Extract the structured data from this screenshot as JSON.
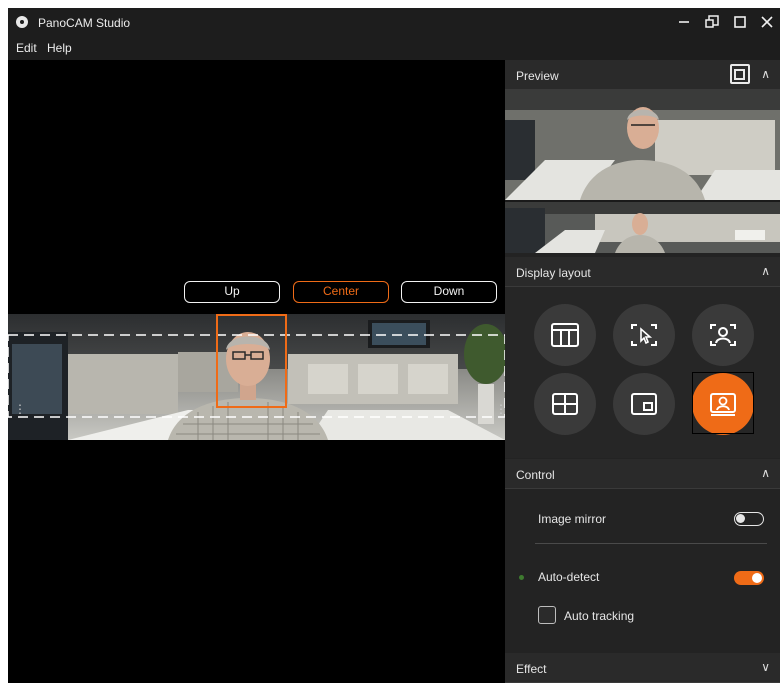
{
  "titlebar": {
    "title": "PanoCAM Studio",
    "app_icon": "camera-lens-icon",
    "controls": [
      "minimize-icon",
      "restore-icon",
      "maximize-icon",
      "close-icon"
    ]
  },
  "menu": {
    "items": [
      "Edit",
      "Help"
    ]
  },
  "video": {
    "buttons": [
      {
        "label": "Up",
        "active": false
      },
      {
        "label": "Center",
        "active": true
      },
      {
        "label": "Down",
        "active": false
      }
    ]
  },
  "panel": {
    "preview": {
      "title": "Preview",
      "icon": "picture-in-picture-collapse-icon"
    },
    "display_layout": {
      "title": "Display layout",
      "options": [
        {
          "icon": "grid-layout-icon",
          "active": false
        },
        {
          "icon": "cursor-frame-icon",
          "active": false
        },
        {
          "icon": "person-frame-icon",
          "active": false
        },
        {
          "icon": "quad-layout-icon",
          "active": false
        },
        {
          "icon": "pip-layout-icon",
          "active": false
        },
        {
          "icon": "presenter-layout-icon",
          "active": true
        }
      ]
    },
    "control": {
      "title": "Control",
      "image_mirror": {
        "label": "Image mirror",
        "on": false
      },
      "auto_detect": {
        "label": "Auto-detect",
        "on": true
      },
      "auto_tracking": {
        "label": "Auto tracking",
        "checked": false
      }
    },
    "effect": {
      "title": "Effect"
    }
  },
  "colors": {
    "accent": "#ef6b17",
    "background": "#000000",
    "panel": "#232323"
  }
}
